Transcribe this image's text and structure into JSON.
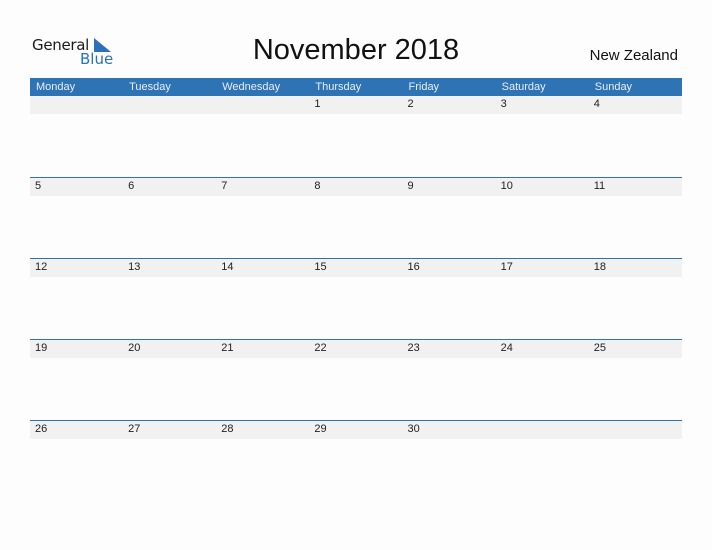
{
  "logo": {
    "line1": "General",
    "line2": "Blue"
  },
  "title": "November 2018",
  "country": "New Zealand",
  "colors": {
    "accent": "#2e73b3",
    "date_strip": "#f1f1f1"
  },
  "weekdays": [
    "Monday",
    "Tuesday",
    "Wednesday",
    "Thursday",
    "Friday",
    "Saturday",
    "Sunday"
  ],
  "weeks": [
    [
      "",
      "",
      "",
      "1",
      "2",
      "3",
      "4"
    ],
    [
      "5",
      "6",
      "7",
      "8",
      "9",
      "10",
      "11"
    ],
    [
      "12",
      "13",
      "14",
      "15",
      "16",
      "17",
      "18"
    ],
    [
      "19",
      "20",
      "21",
      "22",
      "23",
      "24",
      "25"
    ],
    [
      "26",
      "27",
      "28",
      "29",
      "30",
      "",
      ""
    ]
  ]
}
